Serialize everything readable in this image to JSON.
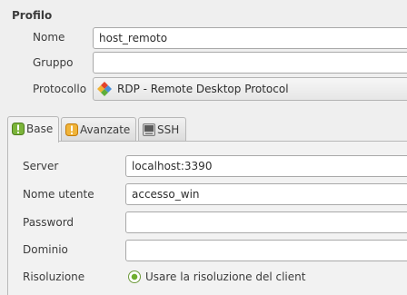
{
  "profile": {
    "section_title": "Profilo",
    "name_label": "Nome",
    "name_value": "host_remoto",
    "group_label": "Gruppo",
    "group_value": "",
    "protocol_label": "Protocollo",
    "protocol_value": "RDP - Remote Desktop Protocol",
    "protocol_icon": "rdp-protocol-icon"
  },
  "tabs": [
    {
      "label": "Base",
      "icon": "base-info-icon",
      "color": "#7bb43a"
    },
    {
      "label": "Avanzate",
      "icon": "warning-icon",
      "color": "#e8a21b"
    },
    {
      "label": "SSH",
      "icon": "ssh-terminal-icon",
      "color": "#7a7a7a"
    }
  ],
  "base": {
    "server_label": "Server",
    "server_value": "localhost:3390",
    "username_label": "Nome utente",
    "username_value": "accesso_win",
    "password_label": "Password",
    "password_value": "",
    "domain_label": "Dominio",
    "domain_value": "",
    "resolution_label": "Risoluzione",
    "resolution_option": "Usare la risoluzione del client",
    "resolution_selected": true
  },
  "colors": {
    "window_bg": "#efefef",
    "accent_green": "#6fae2f"
  }
}
